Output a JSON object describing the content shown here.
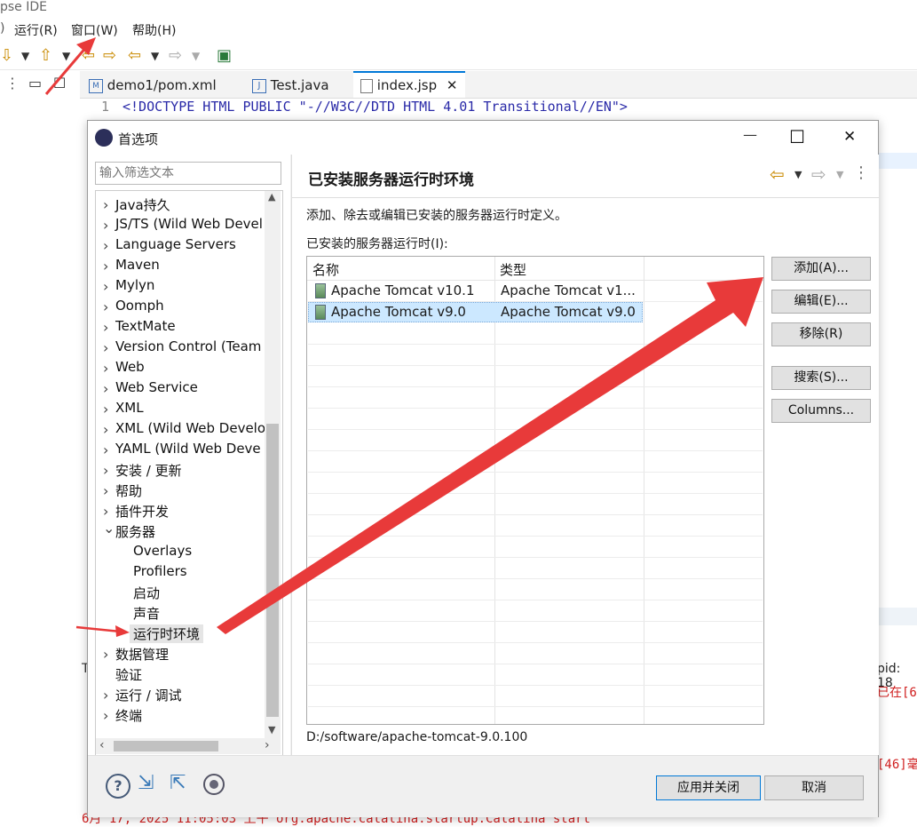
{
  "ide": {
    "title": "pse IDE",
    "menu": [
      "运行(R)",
      "窗口(W)",
      "帮助(H)"
    ],
    "tabs": [
      {
        "label": "demo1/pom.xml",
        "icon": "maven-file-icon"
      },
      {
        "label": "Test.java",
        "icon": "java-file-icon"
      },
      {
        "label": "index.jsp",
        "icon": "jsp-file-icon",
        "close": "✕"
      }
    ],
    "editor": {
      "line_no": "1",
      "code": "<!DOCTYPE HTML PUBLIC \"-//W3C//DTD HTML 4.01 Transitional//EN\">"
    },
    "console": {
      "right_a": "pid: 18",
      "right_b": "已在[6",
      "right_c": "[46]毫",
      "last_line": "6月 17, 2025 11:05:03 上午 org.apache.catalina.startup.Catalina start",
      "tab_left": "T"
    }
  },
  "dialog": {
    "title": "首选项",
    "filter_placeholder": "输入筛选文本",
    "tree": [
      {
        "label": "Java持久",
        "expander": "›"
      },
      {
        "label": "JS/TS (Wild Web Devel",
        "expander": "›"
      },
      {
        "label": "Language Servers",
        "expander": "›"
      },
      {
        "label": "Maven",
        "expander": "›"
      },
      {
        "label": "Mylyn",
        "expander": "›"
      },
      {
        "label": "Oomph",
        "expander": "›"
      },
      {
        "label": "TextMate",
        "expander": "›"
      },
      {
        "label": "Version Control (Team",
        "expander": "›"
      },
      {
        "label": "Web",
        "expander": "›"
      },
      {
        "label": "Web Service",
        "expander": "›"
      },
      {
        "label": "XML",
        "expander": "›"
      },
      {
        "label": "XML (Wild Web Develo",
        "expander": "›"
      },
      {
        "label": "YAML (Wild Web Deve",
        "expander": "›"
      },
      {
        "label": "安装 / 更新",
        "expander": "›"
      },
      {
        "label": "帮助",
        "expander": "›"
      },
      {
        "label": "插件开发",
        "expander": "›"
      },
      {
        "label": "服务器",
        "expander": "⌄"
      },
      {
        "label": "Overlays",
        "expander": ""
      },
      {
        "label": "Profilers",
        "expander": ""
      },
      {
        "label": "启动",
        "expander": ""
      },
      {
        "label": "声音",
        "expander": ""
      },
      {
        "label": "运行时环境",
        "expander": ""
      },
      {
        "label": "数据管理",
        "expander": "›"
      },
      {
        "label": "验证",
        "expander": ""
      },
      {
        "label": "运行 / 调试",
        "expander": "›"
      },
      {
        "label": "终端",
        "expander": "›"
      }
    ],
    "page_title": "已安装服务器运行时环境",
    "description": "添加、除去或编辑已安装的服务器运行时定义。",
    "table_label": "已安装的服务器运行时(I):",
    "columns": [
      "名称",
      "类型"
    ],
    "rows": [
      {
        "name": "Apache Tomcat v10.1",
        "type": "Apache Tomcat v1..."
      },
      {
        "name": "Apache Tomcat v9.0",
        "type": "Apache Tomcat v9.0"
      }
    ],
    "buttons": {
      "add": "添加(A)...",
      "edit": "编辑(E)...",
      "remove": "移除(R)",
      "search": "搜索(S)...",
      "columns": "Columns..."
    },
    "path": "D:/software/apache-tomcat-9.0.100",
    "apply_close": "应用并关闭",
    "cancel": "取消",
    "window_controls": {
      "minimize": "—",
      "maximize": "☐",
      "close": "✕"
    }
  },
  "colors": {
    "annotation": "#e83a3a",
    "selection": "#cce8ff",
    "accent": "#0078d7"
  }
}
